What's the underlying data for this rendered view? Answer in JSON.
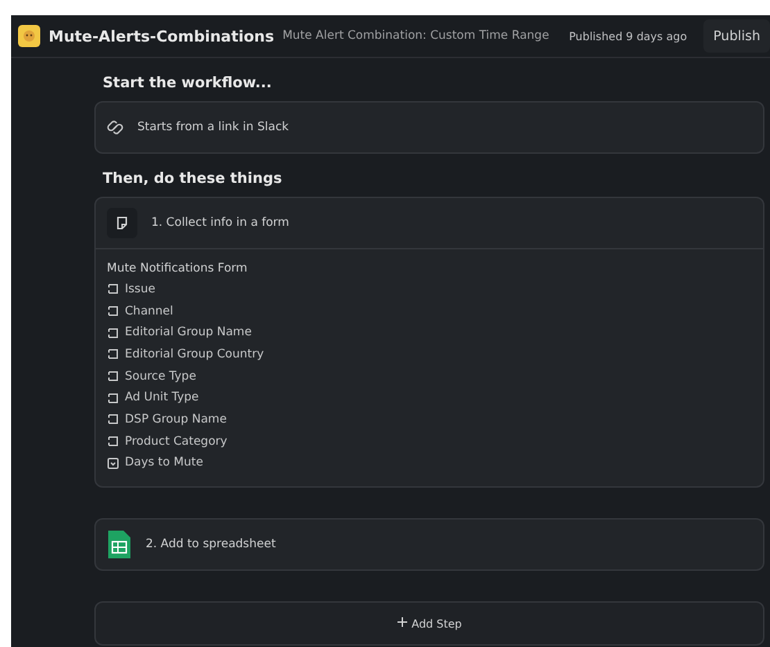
{
  "header": {
    "app_name": "Mute-Alerts-Combinations",
    "subtitle": "Mute Alert Combination: Custom Time Range",
    "status": "Published 9 days ago",
    "publish_button": "Publish"
  },
  "trigger_section": {
    "title": "Start the workflow...",
    "trigger": "Starts from a link in Slack"
  },
  "steps_section": {
    "title": "Then, do these things",
    "steps": [
      {
        "kind": "form",
        "label": "1. Collect info in a form",
        "form_title": "Mute Notifications Form",
        "fields": [
          {
            "kind": "text",
            "label": "Issue"
          },
          {
            "kind": "text",
            "label": "Channel"
          },
          {
            "kind": "text",
            "label": "Editorial Group Name"
          },
          {
            "kind": "text",
            "label": "Editorial Group Country"
          },
          {
            "kind": "text",
            "label": "Source Type"
          },
          {
            "kind": "text",
            "label": "Ad Unit Type"
          },
          {
            "kind": "text",
            "label": "DSP Group Name"
          },
          {
            "kind": "text",
            "label": "Product Category"
          },
          {
            "kind": "select",
            "label": "Days to Mute"
          }
        ]
      },
      {
        "kind": "spreadsheet",
        "label": "2. Add to spreadsheet"
      }
    ]
  },
  "add_step_button": "Add Step"
}
